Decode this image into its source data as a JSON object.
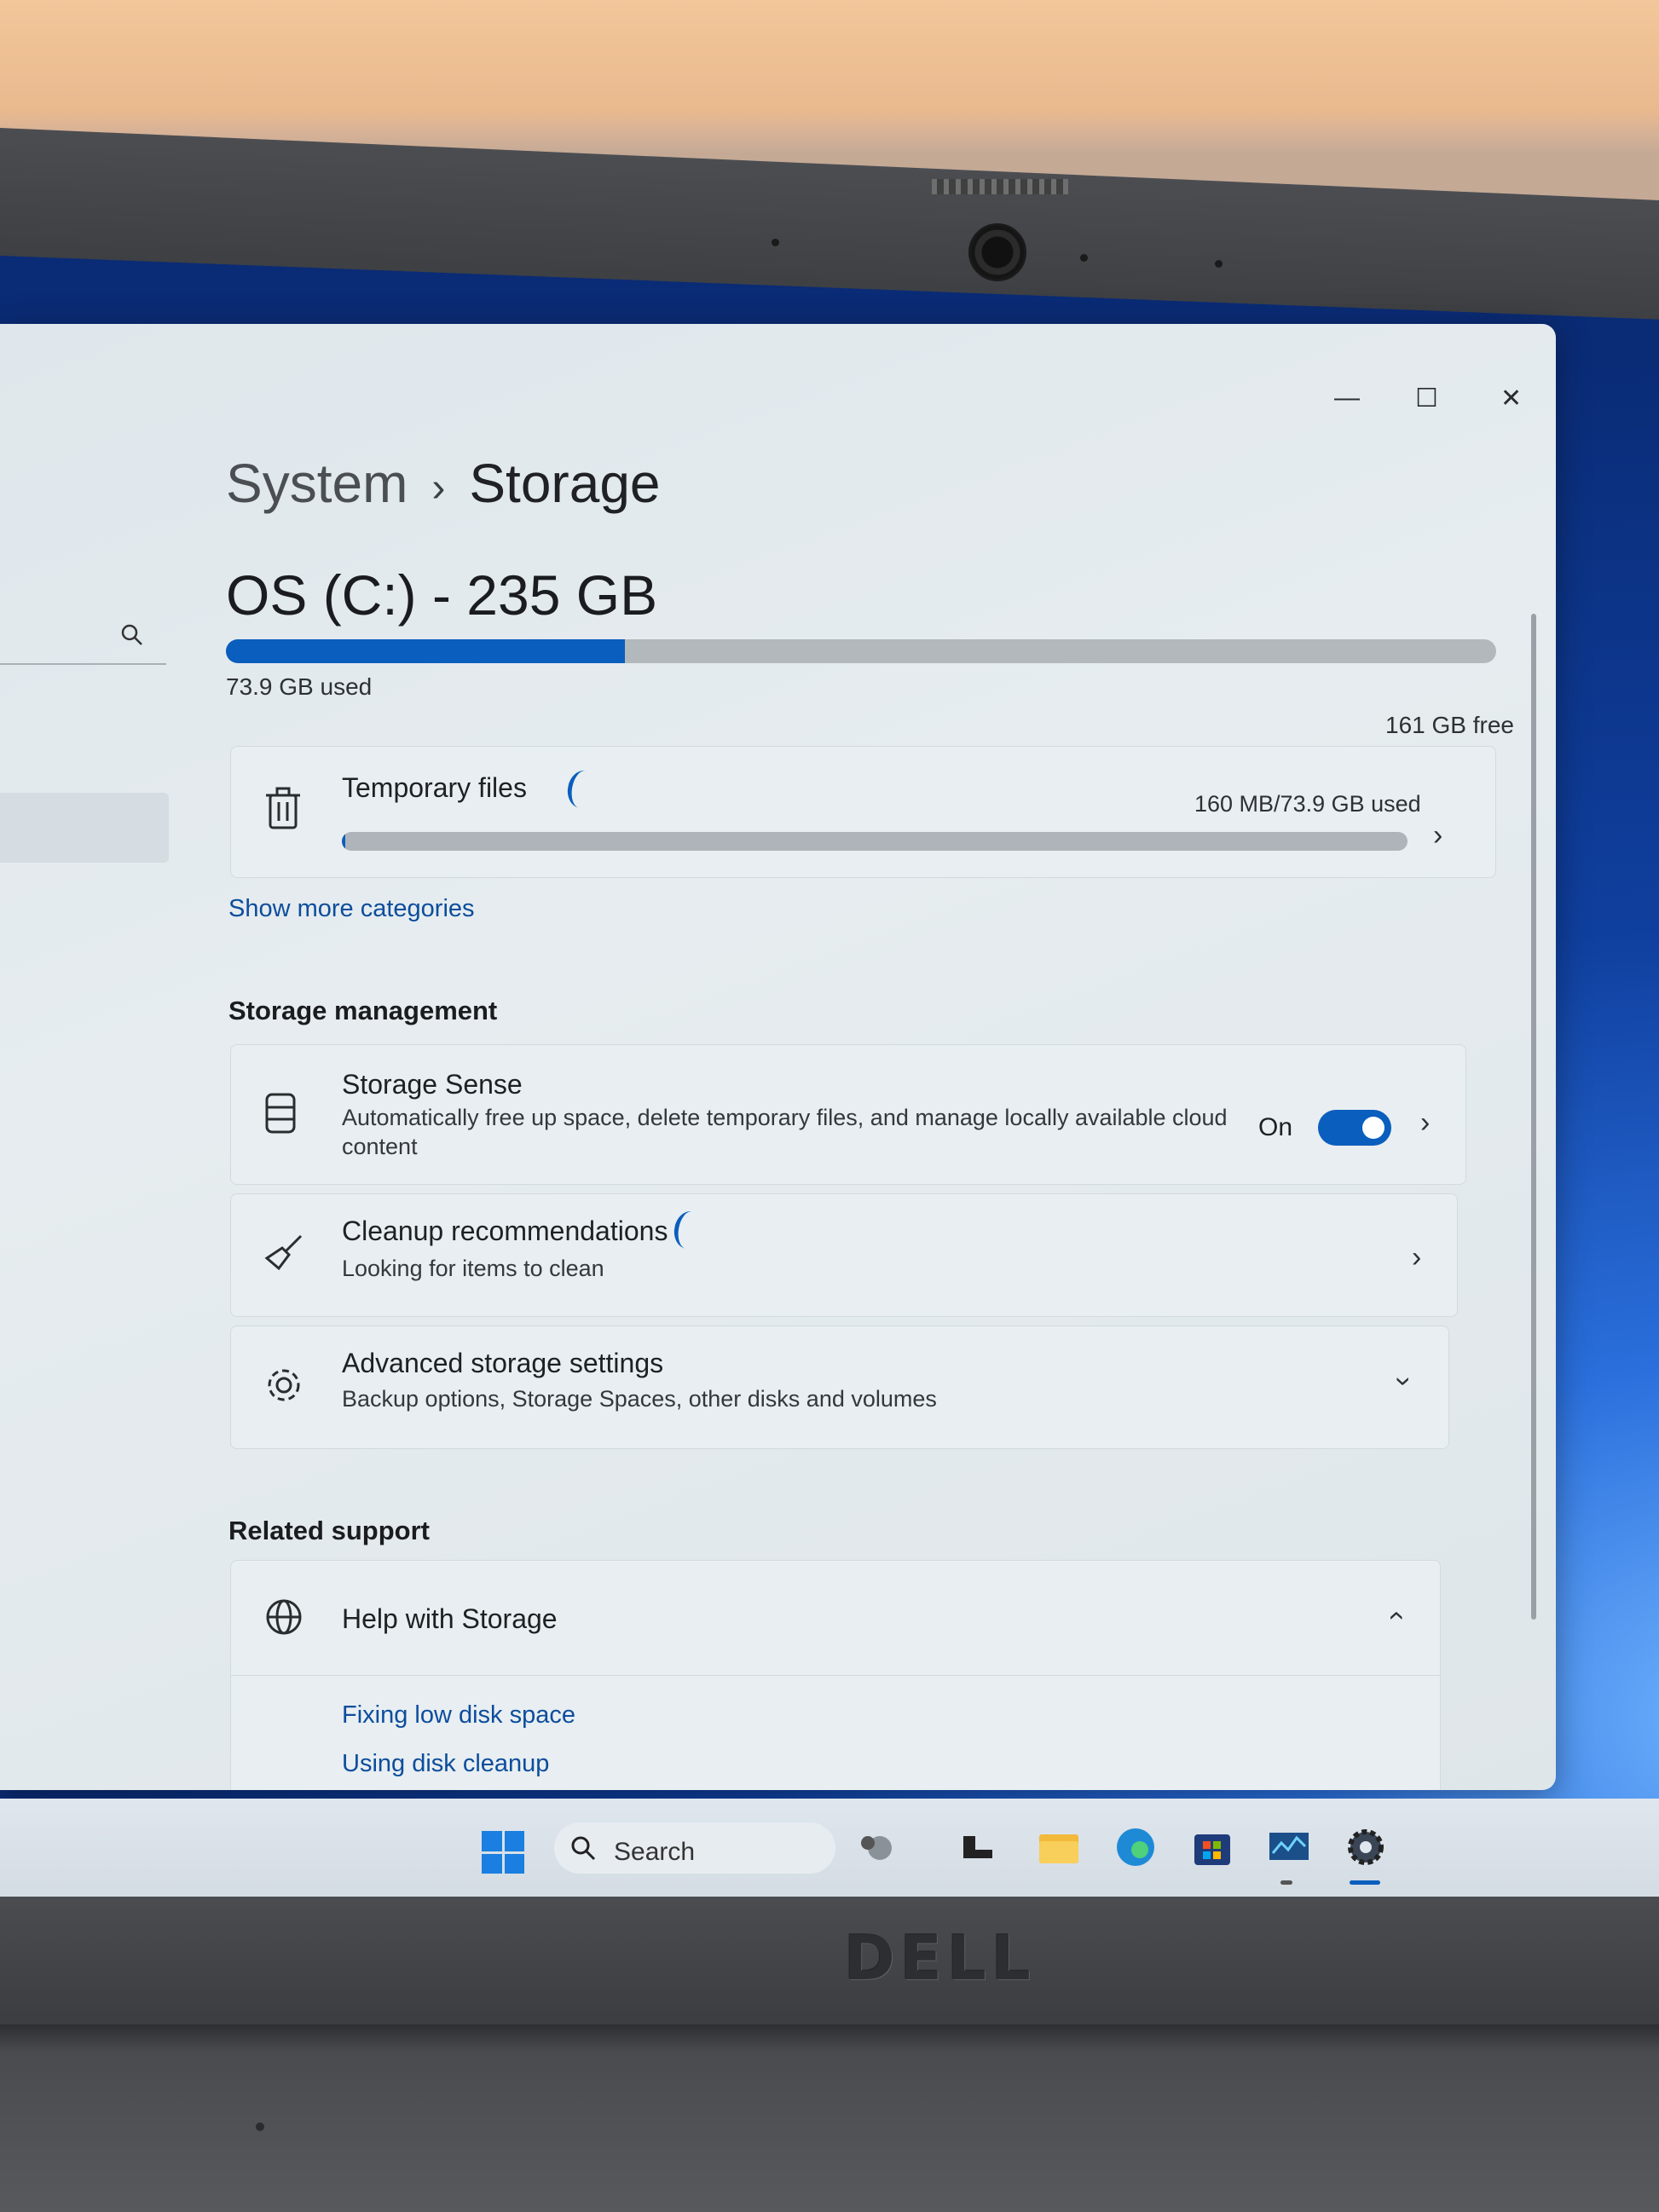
{
  "window": {
    "minimize_glyph": "—",
    "maximize_glyph": "☐",
    "close_glyph": "✕"
  },
  "breadcrumb": {
    "parent": "System",
    "separator": "›",
    "current": "Storage"
  },
  "drive": {
    "title": "OS (C:) - 235 GB",
    "used_label": "73.9 GB used",
    "free_label": "161 GB free",
    "used_fraction": 0.314
  },
  "temporary_files": {
    "label": "Temporary files",
    "usage": "160 MB/73.9 GB used",
    "fraction": 0.002,
    "icon": "trash-icon"
  },
  "show_more": "Show more categories",
  "storage_management": {
    "heading": "Storage management",
    "storage_sense": {
      "title": "Storage Sense",
      "subtitle_line1": "Automatically free up space, delete temporary files, and manage locally available cloud",
      "subtitle_line2": "content",
      "state_label": "On",
      "enabled": true,
      "icon": "storage-drive-icon"
    },
    "cleanup": {
      "title": "Cleanup recommendations",
      "subtitle": "Looking for items to clean",
      "icon": "broom-icon"
    },
    "advanced": {
      "title": "Advanced storage settings",
      "subtitle": "Backup options, Storage Spaces, other disks and volumes",
      "icon": "gear-icon"
    }
  },
  "related_support": {
    "heading": "Related support",
    "help": {
      "title": "Help with Storage",
      "icon": "globe-help-icon",
      "links": [
        "Fixing low disk space",
        "Using disk cleanup"
      ]
    }
  },
  "taskbar": {
    "search_label": "Search",
    "brand": "DELL",
    "accent": "#0a5ebd"
  }
}
